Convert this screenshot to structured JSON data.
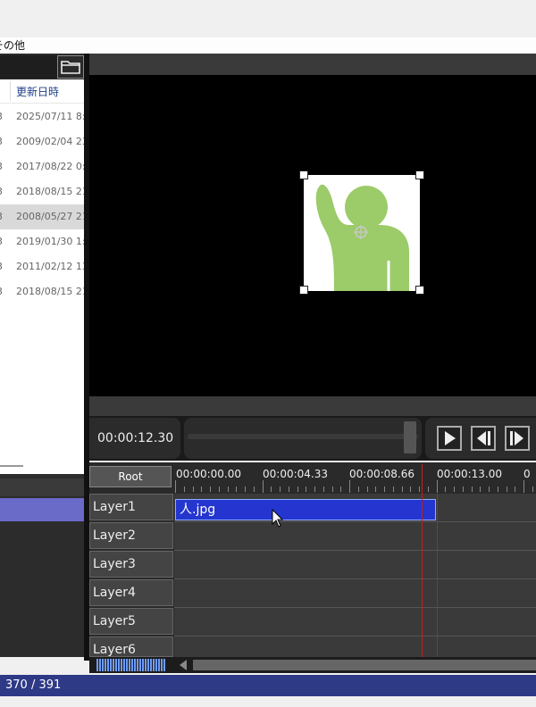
{
  "menubar": {
    "visible_item": "その他"
  },
  "file_panel": {
    "column_header": "更新日時",
    "rows": [
      {
        "prefix": "3",
        "date": "2025/07/11 8:2"
      },
      {
        "prefix": "3",
        "date": "2009/02/04 23:"
      },
      {
        "prefix": "3",
        "date": "2017/08/22 0:1"
      },
      {
        "prefix": "3",
        "date": "2018/08/15 21:"
      },
      {
        "prefix": "3",
        "date": "2008/05/27 21:",
        "selected": true
      },
      {
        "prefix": "3",
        "date": "2019/01/30 1:3"
      },
      {
        "prefix": "3",
        "date": "2011/02/12 13:"
      },
      {
        "prefix": "3",
        "date": "2018/08/15 21:"
      }
    ]
  },
  "player": {
    "timecode": "00:00:12.30",
    "seek_position_fraction": 0.98
  },
  "timeline": {
    "root_label": "Root",
    "ruler_labels": [
      "00:00:00.00",
      "00:00:04.33",
      "00:00:08.66",
      "00:00:13.00",
      "0"
    ],
    "layers": [
      "Layer1",
      "Layer2",
      "Layer3",
      "Layer4",
      "Layer5",
      "Layer6"
    ],
    "clip": {
      "label": "人.jpg",
      "layer": "Layer1",
      "color": "#2436cf"
    },
    "playhead_color": "#c02020"
  },
  "status": {
    "text": "370 / 391",
    "color": "#2e3a86"
  },
  "icons": [
    "folder-icon",
    "play-icon",
    "step-back-icon",
    "step-forward-icon",
    "cursor-icon",
    "scroll-left-icon"
  ]
}
